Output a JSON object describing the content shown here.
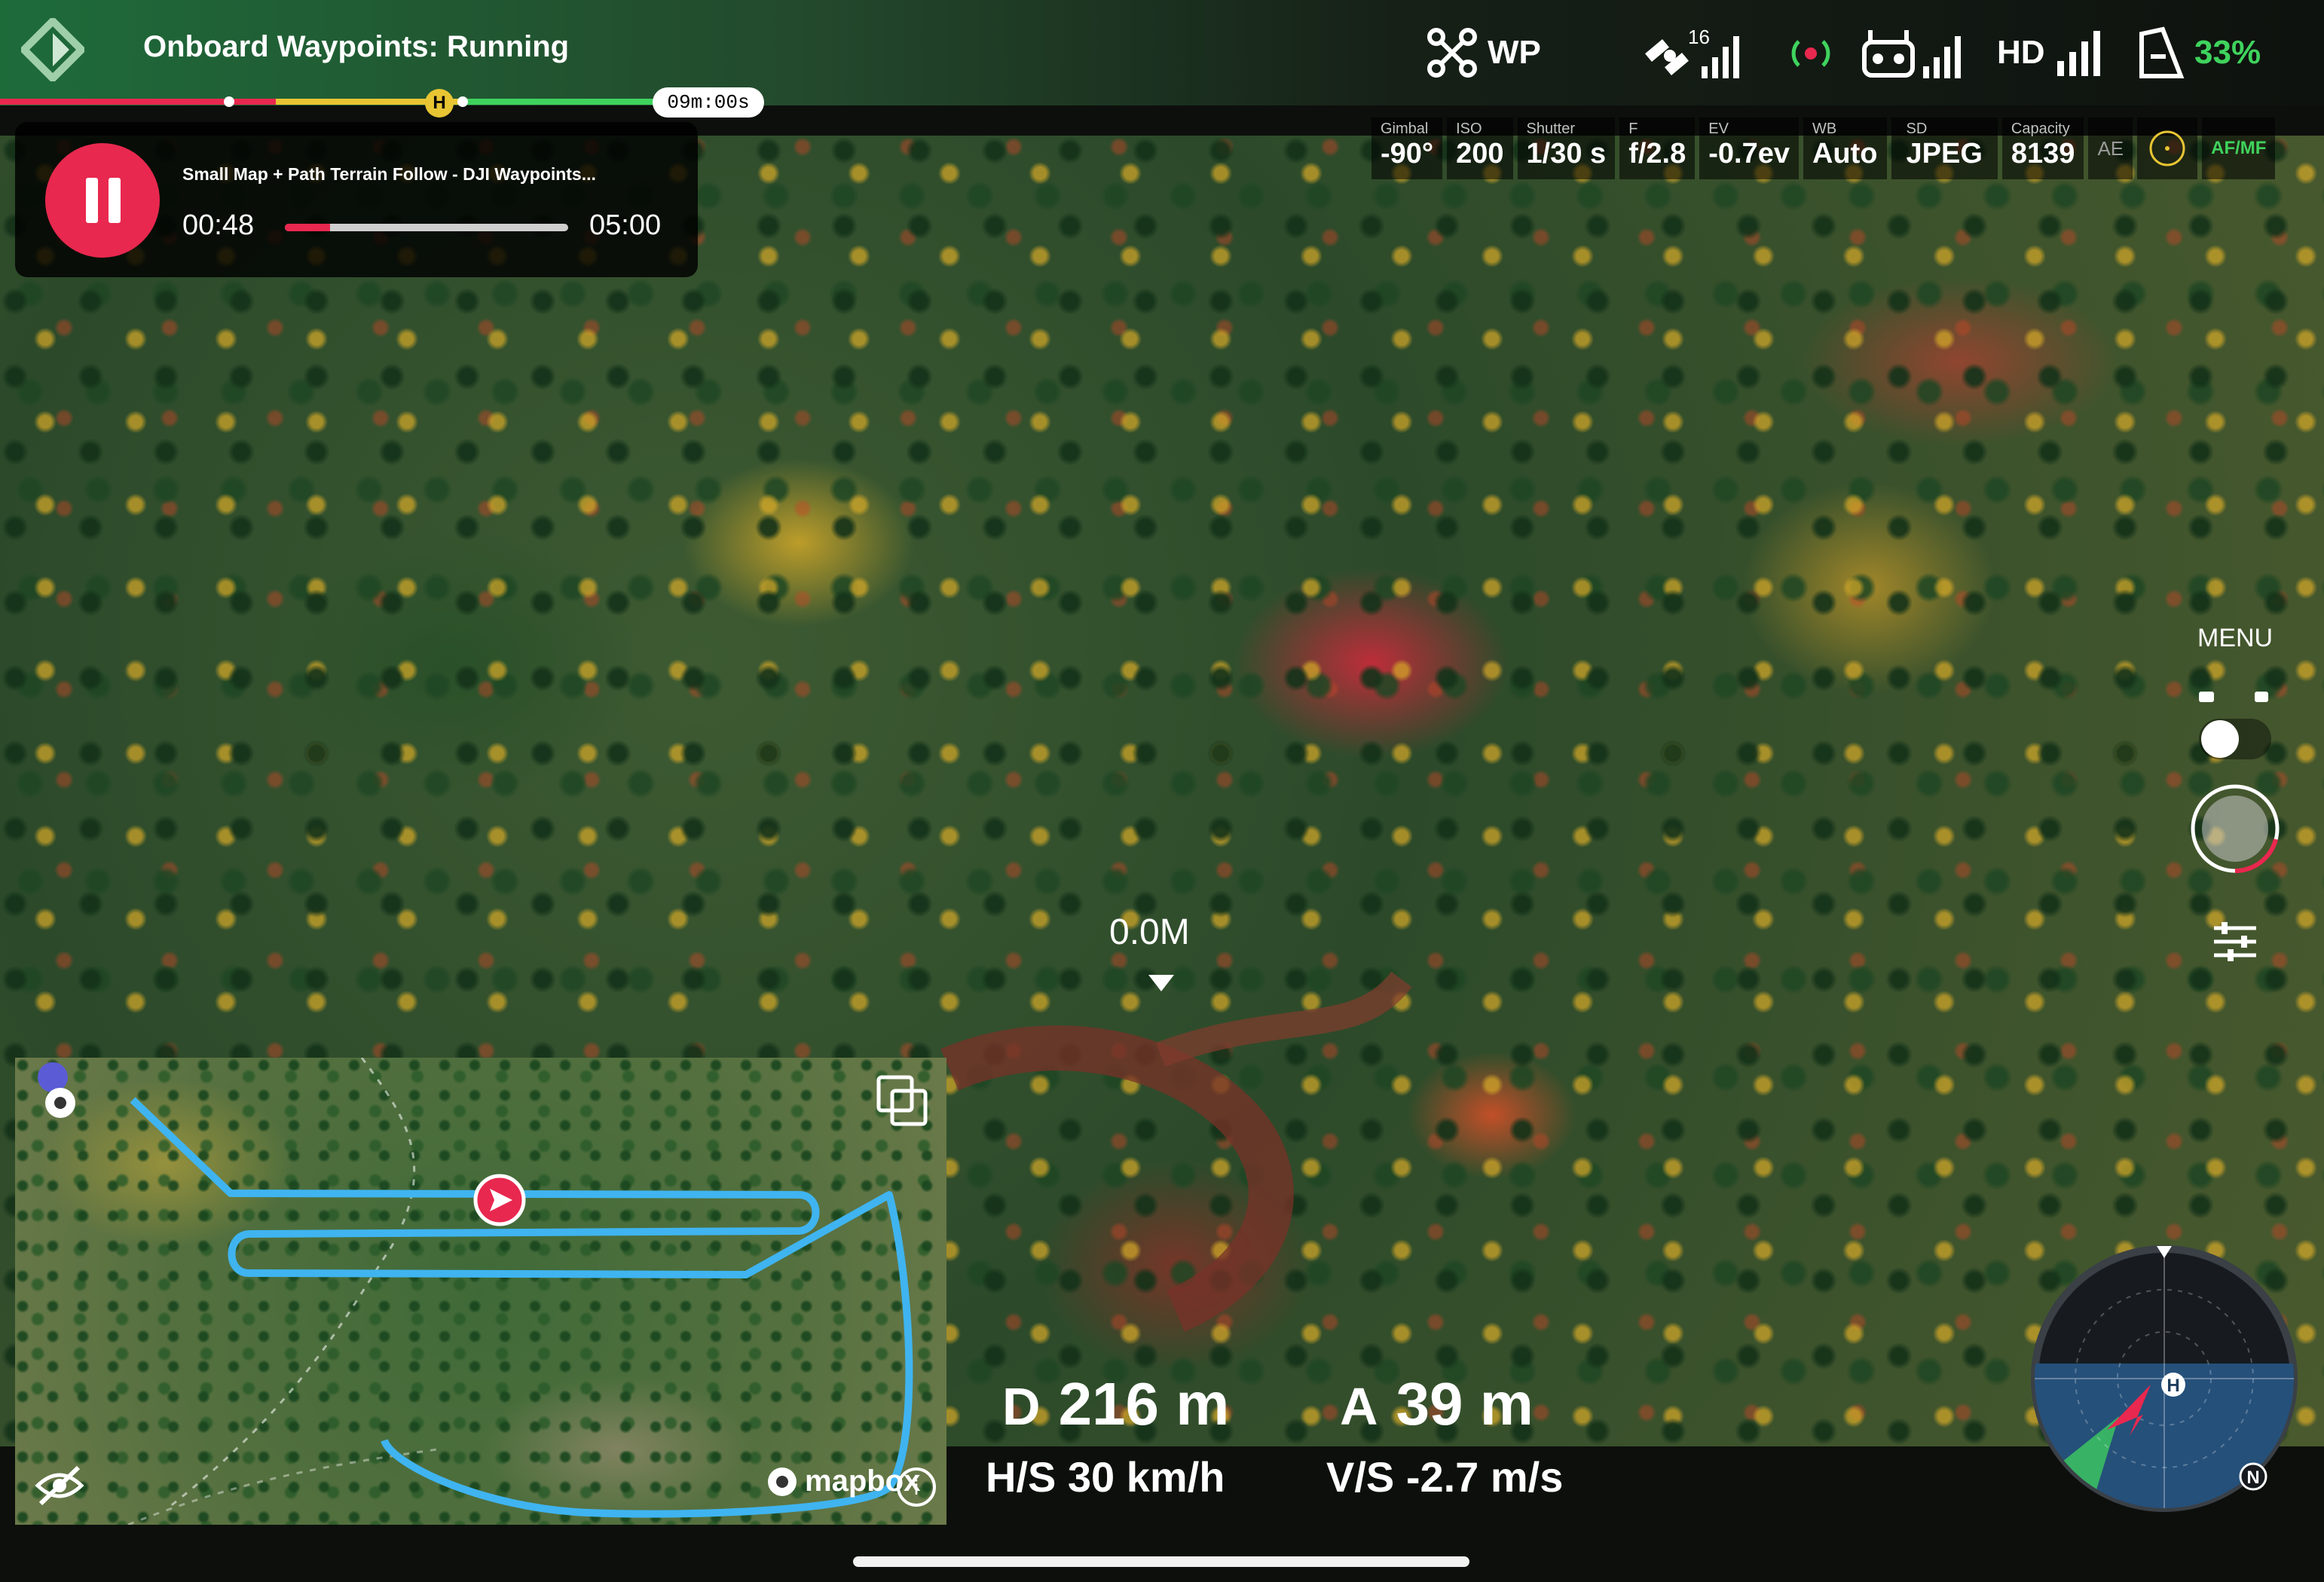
{
  "header": {
    "title": "Onboard Waypoints: Running",
    "mode": "WP",
    "satellites": "16",
    "video_quality": "HD",
    "battery": "33%"
  },
  "timeline": {
    "time": "09m:00s",
    "home_marker": "H",
    "progress_fraction": 0.31
  },
  "camera": {
    "params": [
      {
        "label": "Gimbal",
        "value": "-90°"
      },
      {
        "label": "ISO",
        "value": "200"
      },
      {
        "label": "Shutter",
        "value": "1/30 s"
      },
      {
        "label": "F",
        "value": "f/2.8"
      },
      {
        "label": "EV",
        "value": "-0.7ev"
      },
      {
        "label": "WB",
        "value": "Auto"
      }
    ],
    "format_label": "SD",
    "format": "JPEG",
    "capacity_label": "Capacity",
    "capacity": "8139",
    "ae_label": "AE",
    "focus_mode": "AF/MF"
  },
  "playback": {
    "title": "Small Map + Path Terrain Follow - DJI Waypoints...",
    "elapsed": "00:48",
    "total": "05:00",
    "progress_fraction": 0.16
  },
  "controls": {
    "menu_label": "MENU"
  },
  "feed": {
    "altitude_marker": "0.0M"
  },
  "map": {
    "attribution": "mapbox"
  },
  "telemetry": {
    "distance_key": "D",
    "distance": "216 m",
    "altitude_key": "A",
    "altitude": "39 m",
    "hspeed": "H/S 30 km/h",
    "vspeed": "V/S -2.7 m/s"
  },
  "compass": {
    "home_label": "H",
    "north_label": "N"
  },
  "colors": {
    "accent_red": "#e8284f",
    "battery_green": "#3fd35d",
    "path_blue": "#3fb4f0"
  }
}
